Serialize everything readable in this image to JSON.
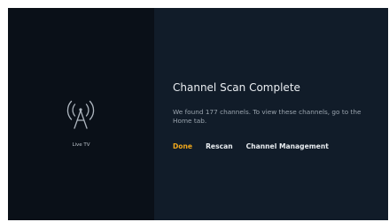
{
  "source": {
    "icon": "antenna-icon",
    "label": "Live TV"
  },
  "dialog": {
    "title": "Channel Scan Complete",
    "message": "We found 177 channels. To view these channels, go to the Home tab.",
    "actions": {
      "done": "Done",
      "rescan": "Rescan",
      "channel_management": "Channel Management"
    },
    "focused_action": "Done"
  },
  "colors": {
    "background": "#101a26",
    "left_panel": "#0a1018",
    "accent": "#f0a81c",
    "text": "#e9edf1",
    "muted_text": "#9aa4ae"
  }
}
